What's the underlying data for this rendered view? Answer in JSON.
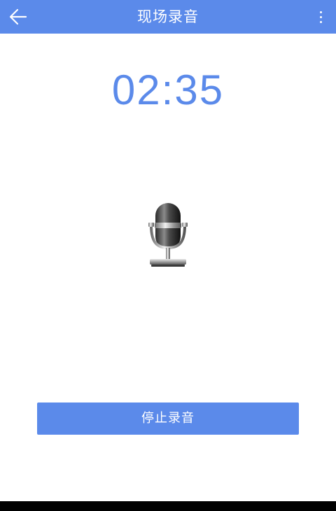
{
  "header": {
    "title": "现场录音",
    "back_icon": "arrow-left-icon",
    "menu_icon": "more-vertical-icon"
  },
  "recording": {
    "elapsed_time": "02:35",
    "mic_icon": "microphone-icon"
  },
  "actions": {
    "stop_label": "停止录音"
  },
  "colors": {
    "accent": "#5b8aea",
    "background": "#ffffff"
  }
}
